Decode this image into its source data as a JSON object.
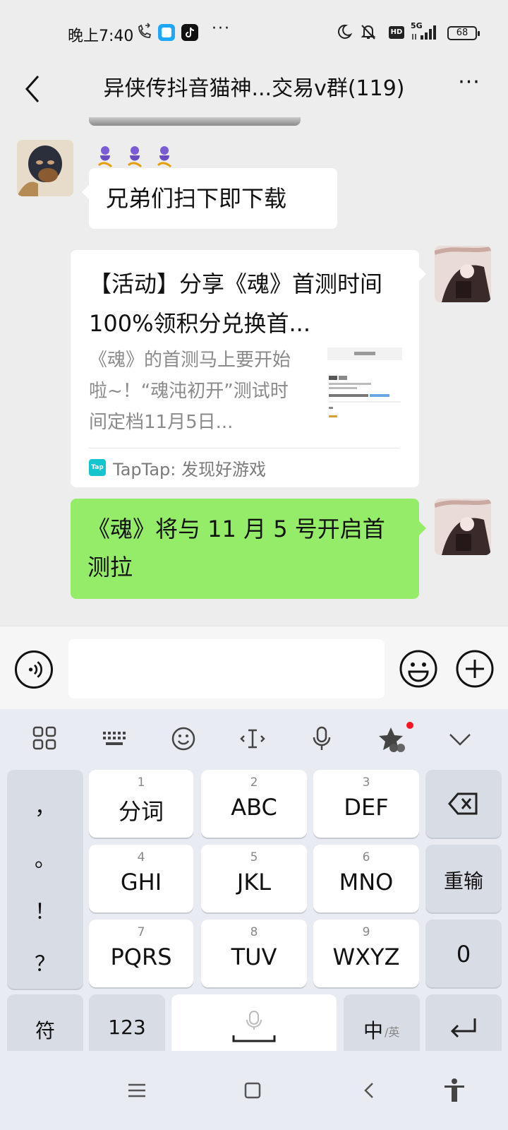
{
  "status_bar": {
    "time": "晚上7:40",
    "network": "5G",
    "hd": "HD",
    "battery": "68",
    "more": "···"
  },
  "header": {
    "title": "异侠传抖音猫神...交易v群(119)",
    "more": "···"
  },
  "messages": [
    {
      "sender": "other",
      "text": "兄弟们扫下即下载"
    },
    {
      "sender": "self",
      "type": "share_card",
      "title": "【活动】分享《魂》首测时间 100%领积分兑换首...",
      "description": "《魂》的首测马上要开始啦~！“魂沌初开”测试时间定档11月5日...",
      "source": "TapTap: 发现好游戏"
    },
    {
      "sender": "self",
      "text": "《魂》将与 11 月 5 号开启首测拉"
    }
  ],
  "input": {
    "value": "",
    "placeholder": ""
  },
  "keyboard": {
    "punct": [
      "，",
      "。",
      "！",
      "？"
    ],
    "keys": [
      {
        "num": "1",
        "label": "分词"
      },
      {
        "num": "2",
        "label": "ABC"
      },
      {
        "num": "3",
        "label": "DEF"
      },
      {
        "num": "4",
        "label": "GHI"
      },
      {
        "num": "5",
        "label": "JKL"
      },
      {
        "num": "6",
        "label": "MNO"
      },
      {
        "num": "7",
        "label": "PQRS"
      },
      {
        "num": "8",
        "label": "TUV"
      },
      {
        "num": "9",
        "label": "WXYZ"
      }
    ],
    "reinput": "重输",
    "zero": "0",
    "symbol": "符",
    "numbers": "123",
    "zh": "中",
    "en": "/英"
  },
  "colors": {
    "bubble_green": "#95ec69",
    "background": "#ededed",
    "keyboard_bg": "#e8ebf1"
  }
}
